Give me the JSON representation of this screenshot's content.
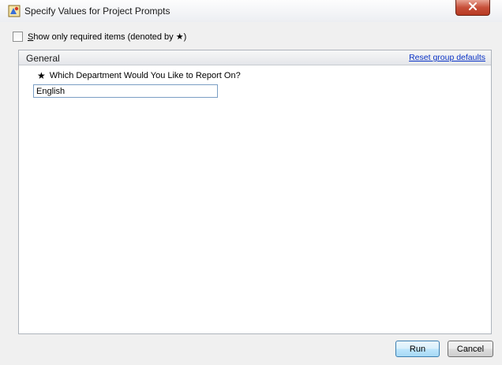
{
  "window": {
    "title": "Specify Values for Project Prompts",
    "icon": "project-prompt-icon"
  },
  "options": {
    "show_required_prefix": "S",
    "show_required_rest": "how only required items (denoted by ",
    "show_required_star": "★",
    "show_required_suffix": ")",
    "checked": false
  },
  "group": {
    "title": "General",
    "reset_label": "Reset group defaults"
  },
  "prompt": {
    "required_marker": "★",
    "label": "Which Department Would You Like to Report On?",
    "value": "English"
  },
  "buttons": {
    "run_label": "Run",
    "cancel_label": "Cancel"
  }
}
